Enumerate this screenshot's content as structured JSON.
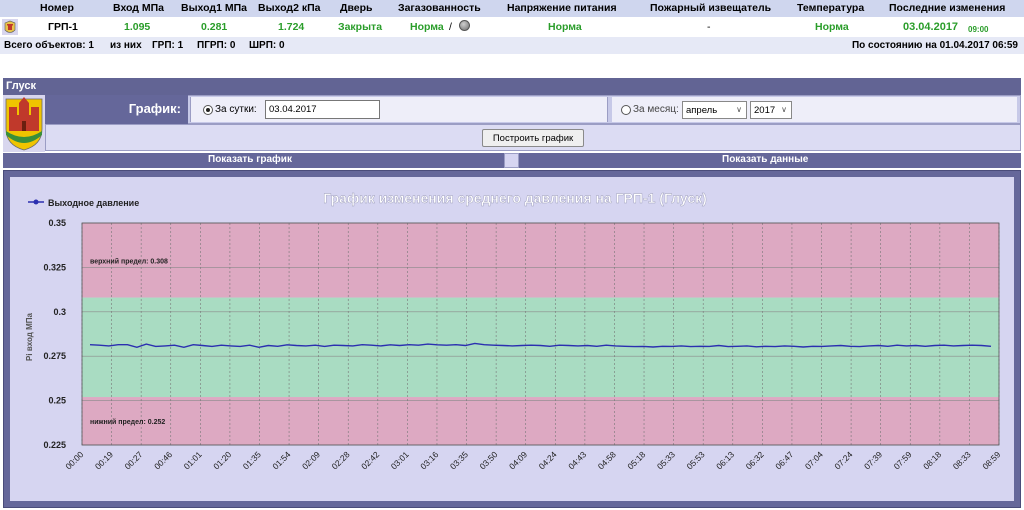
{
  "table": {
    "headers": [
      "Номер",
      "Вход МПа",
      "Выход1 МПа",
      "Выход2 кПа",
      "Дверь",
      "Загазованность",
      "Напряжение питания",
      "Пожарный извещатель",
      "Температура",
      "Последние изменения"
    ],
    "row": {
      "number": "ГРП-1",
      "inlet": "1.095",
      "outlet1": "0.281",
      "outlet2": "1.724",
      "door": "Закрыта",
      "gas": "Норма",
      "gas_sep": "/",
      "voltage": "Норма",
      "fire": "-",
      "temperature": "Норма",
      "last_change_date": "03.04.2017",
      "last_change_time": "09:00"
    },
    "summary": {
      "total": "Всего объектов: 1",
      "of_them": "из них",
      "grp": "ГРП: 1",
      "pgrp": "ПГРП: 0",
      "shrp": "ШРП: 0",
      "as_of": "По состоянию на 01.04.2017 06:59"
    }
  },
  "panel": {
    "title": "Глуск",
    "graph_label": "График:",
    "day_radio_label": "За сутки:",
    "day_value": "03.04.2017",
    "month_radio_label": "За месяц:",
    "month_value": "апрель",
    "year_value": "2017",
    "build_button": "Построить график",
    "tab_show_graph": "Показать график",
    "tab_show_data": "Показать данные"
  },
  "colors": {
    "header_bg": "#cfd6ee",
    "panel_title_bg": "#626494",
    "zone_red": "#dda9c2",
    "zone_green": "#a9dcc2",
    "line": "#2b2fb0",
    "status_green": "#2a9d2a"
  },
  "chart_data": {
    "type": "line",
    "title": "График изменения среднего давления на ГРП-1 (Глуск)",
    "ylabel": "Pi вход МПа",
    "xlabel": "",
    "legend": "top-left",
    "grid": true,
    "ylim": [
      0.225,
      0.35
    ],
    "yticks": [
      "0.35",
      "0.325",
      "0.3",
      "0.275",
      "0.25",
      "0.225"
    ],
    "upper_limit": {
      "value": 0.308,
      "label": "верхний предел: 0.308"
    },
    "lower_limit": {
      "value": 0.252,
      "label": "нижний предел: 0.252"
    },
    "x_ticks": [
      "00:00",
      "00:19",
      "00:27",
      "00:46",
      "01:01",
      "01:20",
      "01:35",
      "01:54",
      "02:09",
      "02:28",
      "02:42",
      "03:01",
      "03:16",
      "03:35",
      "03:50",
      "04:09",
      "04:24",
      "04:43",
      "04:58",
      "05:18",
      "05:33",
      "05:53",
      "06:13",
      "06:32",
      "06:47",
      "07:04",
      "07:24",
      "07:39",
      "07:59",
      "08:18",
      "08:33",
      "08:59"
    ],
    "series": [
      {
        "name": "Выходное давление",
        "values": [
          0.2815,
          0.2812,
          0.2808,
          0.2815,
          0.2815,
          0.28,
          0.2818,
          0.2805,
          0.2808,
          0.2812,
          0.28,
          0.2815,
          0.281,
          0.2805,
          0.2812,
          0.2808,
          0.2805,
          0.2812,
          0.28,
          0.281,
          0.2806,
          0.2814,
          0.281,
          0.2808,
          0.2812,
          0.2805,
          0.2812,
          0.281,
          0.2808,
          0.2815,
          0.2812,
          0.2808,
          0.2814,
          0.281,
          0.2815,
          0.2812,
          0.2818,
          0.2814,
          0.2812,
          0.2815,
          0.281,
          0.2822,
          0.2815,
          0.2812,
          0.281,
          0.2808,
          0.281,
          0.2812,
          0.281,
          0.2806,
          0.2812,
          0.281,
          0.2808,
          0.281,
          0.2806,
          0.2812,
          0.2808,
          0.2806,
          0.2804,
          0.2805,
          0.2802,
          0.2806,
          0.2805,
          0.2808,
          0.2804,
          0.2806,
          0.2805,
          0.281,
          0.2804,
          0.2806,
          0.2808,
          0.2803,
          0.2806,
          0.2804,
          0.2808,
          0.2806,
          0.2802,
          0.2806,
          0.2805,
          0.2808,
          0.281,
          0.2806,
          0.2804,
          0.2808,
          0.281,
          0.2806,
          0.2812,
          0.2808,
          0.281,
          0.2806,
          0.281,
          0.2812,
          0.2808,
          0.281,
          0.2812,
          0.281,
          0.2806
        ]
      }
    ]
  }
}
